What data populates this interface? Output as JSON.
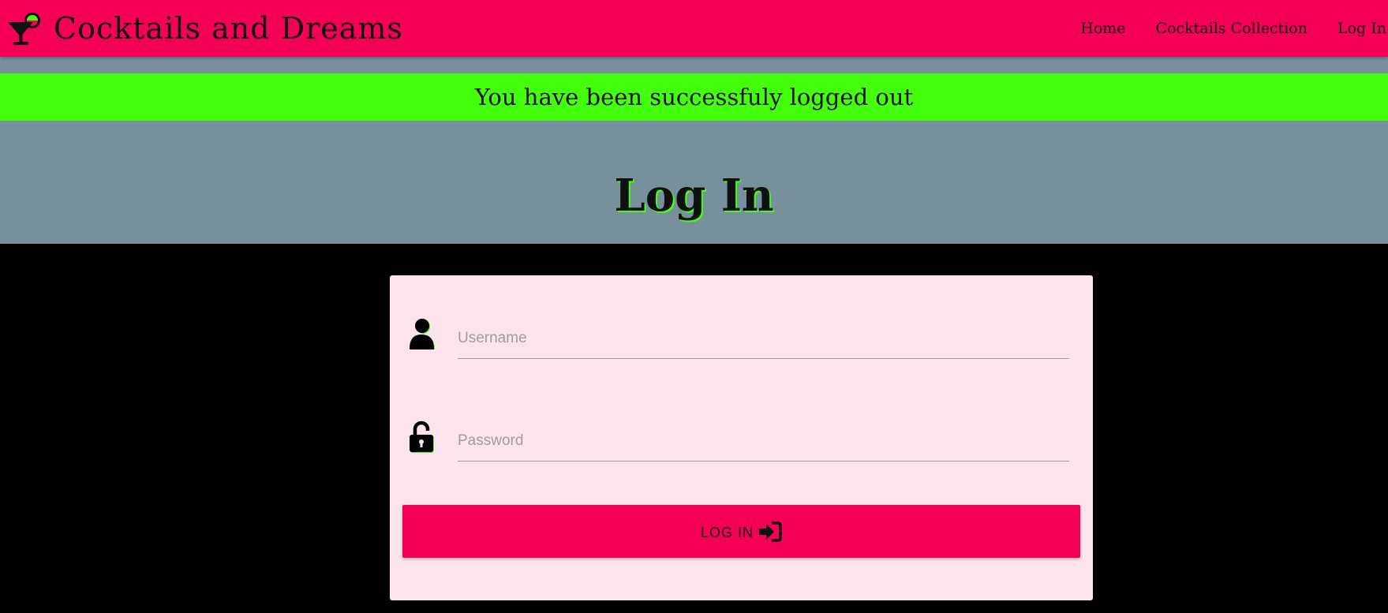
{
  "navbar": {
    "brand_title": "Cocktails and Dreams",
    "brand_icon": "cocktail-icon",
    "links": [
      {
        "label": "Home"
      },
      {
        "label": "Cocktails Collection"
      },
      {
        "label": "Log In"
      }
    ],
    "background": "#f50057"
  },
  "flash": {
    "message": "You have been successfuly logged out",
    "background": "#43ff0b"
  },
  "hero": {
    "title": "Log In",
    "background": "#78909c"
  },
  "login_form": {
    "username": {
      "icon": "user-icon",
      "placeholder": "Username",
      "value": ""
    },
    "password": {
      "icon": "unlock-icon",
      "placeholder": "Password",
      "value": ""
    },
    "submit": {
      "label": "LOG IN",
      "icon": "sign-in-icon"
    },
    "card_background": "#fce4ec"
  },
  "page_background": "#000000"
}
